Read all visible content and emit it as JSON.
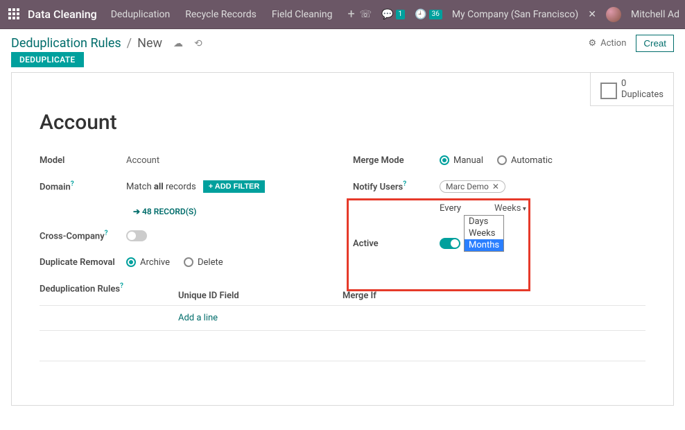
{
  "topbar": {
    "brand": "Data Cleaning",
    "nav": [
      "Deduplication",
      "Recycle Records",
      "Field Cleaning"
    ],
    "msg_count": "1",
    "clock_count": "36",
    "company": "My Company (San Francisco)",
    "user": "Mitchell Ad"
  },
  "crumb": {
    "root": "Deduplication Rules",
    "current": "New",
    "action": "Action",
    "create": "Creat"
  },
  "badge": "DEDUPLICATE",
  "dup": {
    "count": "0",
    "label": "Duplicates"
  },
  "title": "Account",
  "left": {
    "model_lbl": "Model",
    "model_val": "Account",
    "domain_lbl": "Domain",
    "match_prefix": "Match",
    "match_mid": "all",
    "match_suffix": "records",
    "add_filter": "+ ADD FILTER",
    "records": "48 RECORD(S)",
    "cross_lbl": "Cross-Company",
    "dup_rem_lbl": "Duplicate Removal",
    "dup_rem_opts": [
      "Archive",
      "Delete"
    ],
    "rules_lbl": "Deduplication Rules"
  },
  "right": {
    "merge_lbl": "Merge Mode",
    "merge_opts": [
      "Manual",
      "Automatic"
    ],
    "notify_lbl": "Notify Users",
    "tag": "Marc Demo",
    "every": "Every",
    "every_val": "",
    "every_unit": "Weeks",
    "dropdown": [
      "Days",
      "Weeks",
      "Months"
    ],
    "active_lbl": "Active"
  },
  "table": {
    "col1": "Unique ID Field",
    "col2": "Merge If",
    "addline": "Add a line"
  }
}
